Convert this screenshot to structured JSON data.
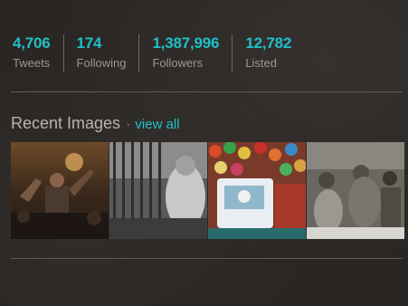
{
  "stats": [
    {
      "value": "4,706",
      "label": "Tweets"
    },
    {
      "value": "174",
      "label": "Following"
    },
    {
      "value": "1,387,996",
      "label": "Followers"
    },
    {
      "value": "12,782",
      "label": "Listed"
    }
  ],
  "recent_images": {
    "title": "Recent Images",
    "separator": "·",
    "view_all": "view all"
  },
  "colors": {
    "accent": "#1fc0c8",
    "background": "#2a2624",
    "label": "#9a9692"
  }
}
